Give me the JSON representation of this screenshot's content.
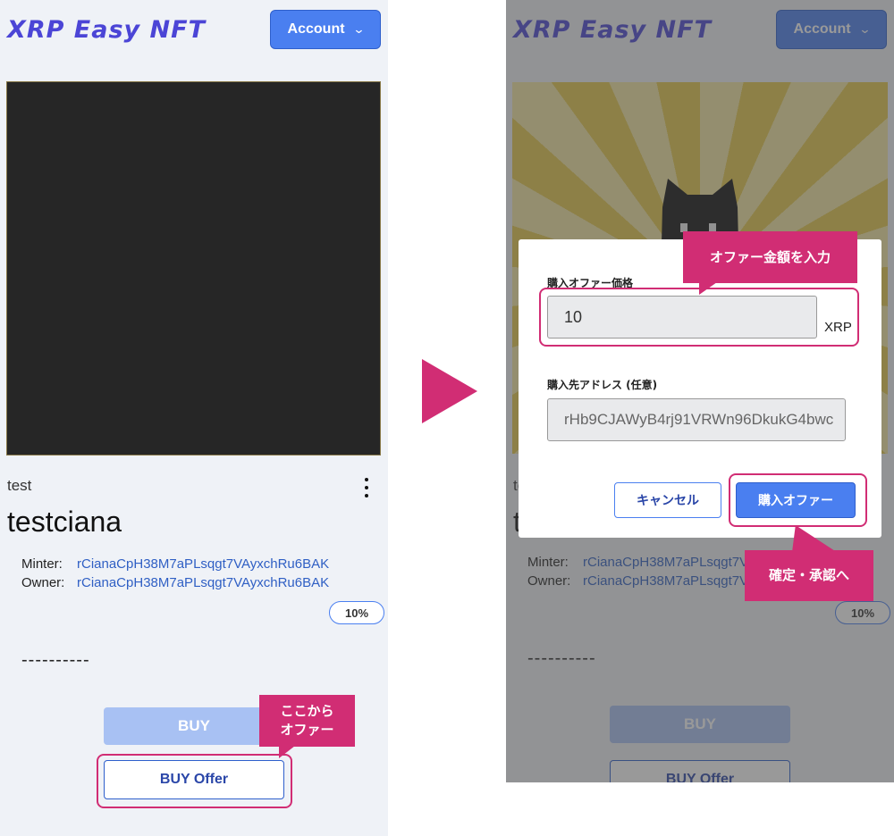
{
  "app": {
    "logo": "XRP Easy NFT",
    "account_label": "Account"
  },
  "nft": {
    "collection": "test",
    "name": "testciana",
    "minter_label": "Minter:",
    "minter_value": "rCianaCpH38M7aPLsqgt7VAyxchRu6BAK",
    "owner_label": "Owner:",
    "owner_value": "rCianaCpH38M7aPLsqgt7VAyxchRu6BAK",
    "royalty": "10%",
    "description": "----------"
  },
  "actions": {
    "buy": "BUY",
    "buy_offer": "BUY Offer"
  },
  "modal": {
    "price_label": "購入オファー価格",
    "price_value": "10",
    "price_unit": "XRP",
    "dest_label": "購入先アドレス (任意)",
    "dest_value": "rHb9CJAWyB4rj91VRWn96DkukG4bwc",
    "cancel": "キャンセル",
    "submit": "購入オファー"
  },
  "annotations": {
    "left_callout_line1": "ここから",
    "left_callout_line2": "オファー",
    "price_callout": "オファー金額を入力",
    "confirm_callout": "確定・承認へ"
  },
  "colors": {
    "accent": "#d12d74",
    "primary": "#4a7ff0",
    "logo": "#4b45d6"
  },
  "icons": {
    "account_chevron": "chevron-down-icon",
    "more": "kebab-menu-icon",
    "arrow": "play-arrow-icon"
  }
}
